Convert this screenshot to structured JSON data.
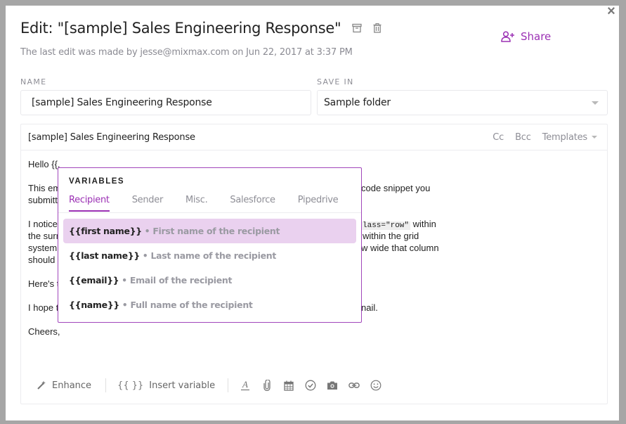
{
  "header": {
    "title": "Edit: \"[sample] Sales Engineering Response\"",
    "subtitle": "The last edit was made by jesse@mixmax.com on Jun 22, 2017 at 3:37 PM",
    "share_label": "Share",
    "close_icon": "×"
  },
  "form": {
    "name_label": "NAME",
    "name_value": "[sample] Sales Engineering Response",
    "save_in_label": "SAVE IN",
    "save_in_value": "Sample folder"
  },
  "editor": {
    "subject": "[sample] Sales Engineering Response",
    "cc_label": "Cc",
    "bcc_label": "Bcc",
    "templates_label": "Templates",
    "body": {
      "p1": "Hello {{,",
      "p2a": "This em",
      "p2a_right": "code snippet you",
      "p2b": "submitt",
      "p3a": "I notice",
      "p3a_code": "lass=\"row\"",
      "p3a_right": " within",
      "p3b": "the surr",
      "p3b_right": "within the grid",
      "p3c": "system",
      "p3c_right": "w wide that column",
      "p3d": "should",
      "p4": "Here's t",
      "p5": "I hope t",
      "p5_right": "nail.",
      "p6": "Cheers,"
    },
    "toolbar": {
      "enhance_label": "Enhance",
      "insert_variable_icon": "{{ }}",
      "insert_variable_label": "Insert variable",
      "icons": [
        "font-color-icon",
        "attachment-icon",
        "calendar-icon",
        "checkmark-icon",
        "camera-icon",
        "link-icon",
        "emoji-icon"
      ]
    }
  },
  "variables_popup": {
    "title": "VARIABLES",
    "tabs": [
      {
        "label": "Recipient",
        "active": true
      },
      {
        "label": "Sender"
      },
      {
        "label": "Misc."
      },
      {
        "label": "Salesforce"
      },
      {
        "label": "Pipedrive"
      }
    ],
    "items": [
      {
        "key": "{{first name}}",
        "desc": "• First name of the recipient",
        "active": true
      },
      {
        "key": "{{last name}}",
        "desc": "• Last name of the recipient"
      },
      {
        "key": "{{email}}",
        "desc": "• Email of the recipient"
      },
      {
        "key": "{{name}}",
        "desc": "• Full name of the recipient"
      }
    ]
  },
  "colors": {
    "accent": "#9b30b4",
    "highlight": "#ead1ef",
    "backdrop": "#a6a6a6"
  }
}
